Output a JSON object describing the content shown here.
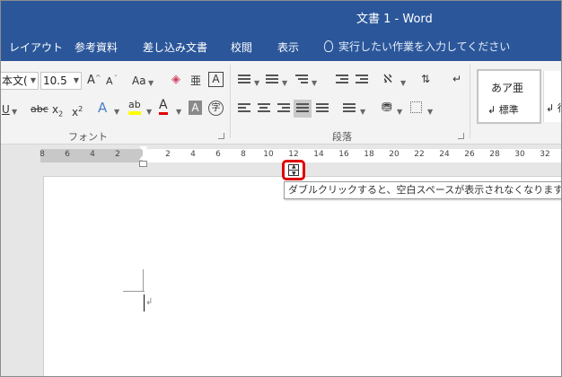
{
  "title": "文書 1 - Word",
  "menu": {
    "items": [
      "レイアウト",
      "参考資料",
      "差し込み文書",
      "校閲",
      "表示"
    ],
    "tell_me": "実行したい作業を入力してください"
  },
  "ribbon": {
    "font_name": "本文(",
    "font_size": "10.5",
    "grow_font": "A",
    "shrink_font": "A",
    "change_case": "Aa",
    "phonetic": "亜",
    "char_border": "A",
    "underline": "U",
    "strike": "abc",
    "subscript": "x",
    "sub_mark": "2",
    "superscript": "x",
    "sup_mark": "2",
    "text_effect": "A",
    "highlight": "ab",
    "font_color": "A",
    "char_shading": "A",
    "enclose_char": "字",
    "font_group_label": "フォント",
    "paragraph_group_label": "段落",
    "style_normal_sample": "あア亜",
    "style_normal_name": "標準",
    "style_next_name": "行",
    "colors": {
      "highlight_yellow": "#ffff00",
      "font_red": "#e00000",
      "accent_blue": "#2b579a"
    }
  },
  "ruler": {
    "left_numbers": [
      "8",
      "6",
      "4",
      "2"
    ],
    "right_numbers": [
      "2",
      "4",
      "6",
      "8",
      "10",
      "12",
      "14",
      "16",
      "18",
      "20",
      "22",
      "24",
      "26",
      "28",
      "30",
      "32"
    ]
  },
  "tooltip": "ダブルクリックすると、空白スペースが表示されなくなります",
  "paragraph_mark": "↲"
}
